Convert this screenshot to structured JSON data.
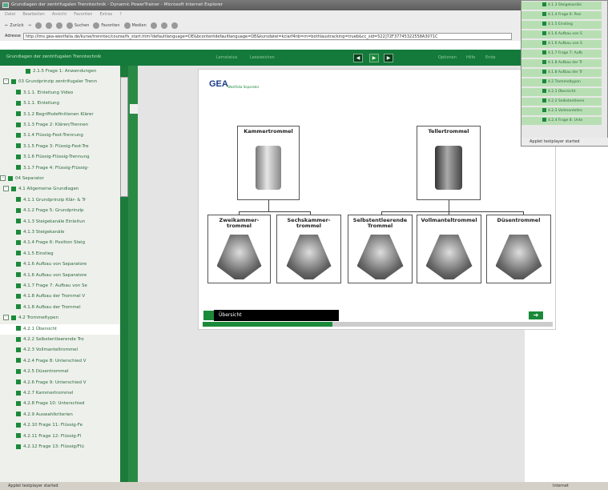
{
  "window": {
    "title": "Grundlagen der zentrifugalen Trenntechnik - Dynamic PowerTrainer - Microsoft Internet Explorer"
  },
  "menu": [
    "Datei",
    "Bearbeiten",
    "Ansicht",
    "Favoriten",
    "Extras",
    "?"
  ],
  "toolbar": {
    "back": "Zurück",
    "search": "Suchen",
    "favorites": "Favoriten",
    "media": "Medien"
  },
  "address": {
    "label": "Adresse",
    "url": "http://lms.gea-westfalia.de/kurse/trenntec/course/fs_start.htm?defaultlanguage=DE&bcontentdefaultlanguage=DE&kursdatei=kclarf4nb=m=bothlaustracking=trueb&cc_sid=522]72F37745322558A3071C"
  },
  "course_bar": {
    "title": "Grundlagen der zentrifugalen Trenntechnik",
    "links": [
      "Lernstatus",
      "Lesezeichen",
      "Optionen",
      "Hilfe",
      "Ende"
    ]
  },
  "tree": [
    {
      "label": "2.1.5 Frage 1: Anwendungen",
      "level": 3
    },
    {
      "label": "03 Grundprinzip zentrifugaler Trenn",
      "level": 1,
      "toggle": "-"
    },
    {
      "label": "3.1.1. Einleitung Video",
      "level": 2
    },
    {
      "label": "3.1.1. Einleitung",
      "level": 2
    },
    {
      "label": "3.1.2 Begriffsdefinitionen Klärer",
      "level": 2
    },
    {
      "label": "3.1.3 Frage 2: Klären/Trennen",
      "level": 2
    },
    {
      "label": "3.1.4 Flüssig-Fest-Trennung",
      "level": 2
    },
    {
      "label": "3.1.5 Frage 3: Flüssig-Fest-Tre",
      "level": 2
    },
    {
      "label": "3.1.6 Flüssig-Flüssig-Trennung",
      "level": 2
    },
    {
      "label": "3.1.7 Frage 4: Flüssig-Flüssig-",
      "level": 2
    },
    {
      "label": "04 Separator",
      "level": 0,
      "toggle": "-"
    },
    {
      "label": "4.1 Allgemeine Grundlagen",
      "level": 1,
      "toggle": "-"
    },
    {
      "label": "4.1.1 Grundprinzip Klär- & Tr",
      "level": 2
    },
    {
      "label": "4.1.2 Frage 5: Grundprinzip",
      "level": 2
    },
    {
      "label": "4.1.3 Steigekanäle Einleitun",
      "level": 2
    },
    {
      "label": "4.1.3 Steigekanäle",
      "level": 2
    },
    {
      "label": "4.1.4 Frage 6: Position Steig",
      "level": 2
    },
    {
      "label": "4.1.5 Einstieg",
      "level": 2
    },
    {
      "label": "4.1.6 Aufbau von Separatore",
      "level": 2
    },
    {
      "label": "4.1.6 Aufbau von Separatore",
      "level": 2
    },
    {
      "label": "4.1.7 Frage 7: Aufbau von Se",
      "level": 2
    },
    {
      "label": "4.1.8 Aufbau der Trommel V",
      "level": 2
    },
    {
      "label": "4.1.8 Aufbau der Trommel",
      "level": 2
    },
    {
      "label": "4.2 Trommeltypen",
      "level": 1,
      "toggle": "-"
    },
    {
      "label": "4.2.1 Übersicht",
      "level": 2,
      "selected": true
    },
    {
      "label": "4.2.2 Selbstentleerende Tro",
      "level": 2
    },
    {
      "label": "4.2.3 Vollmanteltrommel",
      "level": 2
    },
    {
      "label": "4.2.4 Frage 8: Unterschied V",
      "level": 2
    },
    {
      "label": "4.2.5 Düsentrommel",
      "level": 2
    },
    {
      "label": "4.2.6 Frage 9: Unterschied V",
      "level": 2
    },
    {
      "label": "4.2.7 Kammertrommel",
      "level": 2
    },
    {
      "label": "4.2.8 Frage 10: Unterschied",
      "level": 2
    },
    {
      "label": "4.2.9 Auswahlkriterien",
      "level": 2
    },
    {
      "label": "4.2.10 Frage 11: Flüssig-Fe",
      "level": 2
    },
    {
      "label": "4.2.11 Frage 12: Flüssig-Fl",
      "level": 2
    },
    {
      "label": "4.2.12 Frage 13: Flüssig/Flü",
      "level": 2
    }
  ],
  "slide": {
    "logo": "GEA",
    "logo_sub": "Westfalia Separator",
    "top_boxes": [
      "Kammertrommel",
      "Tellertrommel"
    ],
    "bottom_boxes": [
      "Zweikammer-trommel",
      "Sechskammer-trommel",
      "Selbstentleerende Trommel",
      "Vollmanteltrommel",
      "Düsentrommel"
    ],
    "nav_label": "Übersicht",
    "progress": 0.37
  },
  "overlay": {
    "items": [
      "4.1.3 Steigekanäle",
      "4.1.4 Frage 6: Posi",
      "4.1.5 Einstieg",
      "4.1.6 Aufbau von S",
      "4.1.6 Aufbau von S",
      "4.1.7 Frage 7: Aufb",
      "4.1.8 Aufbau der Tr",
      "4.1.8 Aufbau der Tr",
      "4.2 Trommeltypen",
      "4.2.1 Übersicht",
      "4.2.2 Selbstentleere",
      "4.2.3 Vollmanteltro",
      "4.2.4 Frage 8: Unte"
    ],
    "status": "Applet testplayer started"
  },
  "status": {
    "left": "Applet testplayer started",
    "zone": "Internet"
  }
}
